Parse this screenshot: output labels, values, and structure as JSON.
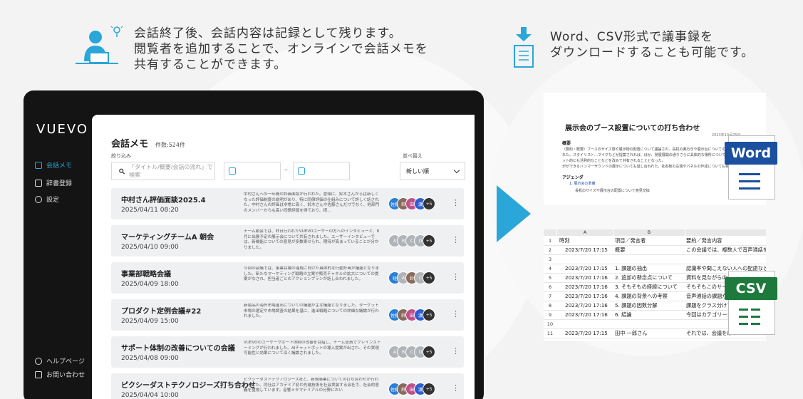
{
  "captions": {
    "left_lines": [
      "会話終了後、会話内容は記録として残ります。",
      "閲覧者を追加することで、オンラインで会話メモを",
      "共有することができます。"
    ],
    "right_lines": [
      "Word、CSV形式で議事録を",
      "ダウンロードすることも可能です。"
    ]
  },
  "app": {
    "logo": "VUEVO",
    "nav": [
      {
        "label": "会話メモ",
        "icon": "memo-icon",
        "active": true
      },
      {
        "label": "辞書登録",
        "icon": "dictionary-icon",
        "active": false
      },
      {
        "label": "設定",
        "icon": "gear-icon",
        "active": false
      }
    ],
    "nav_bottom": [
      {
        "label": "ヘルプページ",
        "icon": "help-icon"
      },
      {
        "label": "お問い合わせ",
        "icon": "mail-icon"
      }
    ],
    "page_title": "会話メモ",
    "count": "件数:524件",
    "filter_label": "絞り込み",
    "search_placeholder": "「タイトル/概要/会話の流れ」で検索",
    "date_separator": "–",
    "sort_label": "並べ替え",
    "sort_value": "新しい順",
    "rows": [
      {
        "title": "中村さん評価面談2025.4",
        "date": "2025/04/11 08:20",
        "summary": "中村さんへの一年間の評価面談が行われた。冒頭に、鈴木さんからは新しくなった評価制度の説明があり、特に同僚評価の仕組みについて詳しく話された。中村さんの評価は非常に高く、鈴木さんや佐藤さんだけでなく、他部門のメンバーからも高い同僚評価を得ており、様…",
        "avatars": [
          {
            "t": "佐藤",
            "c": "#2a7fd4"
          },
          {
            "t": "鈴",
            "c": "#8a6a5a"
          },
          {
            "t": "田",
            "c": "#c0508a"
          },
          {
            "t": "渡",
            "c": "#2f5fd0"
          },
          {
            "t": "+5",
            "c": "#333333"
          }
        ]
      },
      {
        "title": "マーケティングチームA 朝会",
        "date": "2025/04/10 09:00",
        "summary": "チーム朝会では、昨日行われたVUEVOユーザーの方へのインタビューと、8月に出展予定の展示会について共有されました。ユーザーインタビューでは、新機能についての意見が多数寄せられ、期待が高まっていることが分かりました。",
        "avatars": [
          {
            "t": "A",
            "c": "#b0b4b8"
          },
          {
            "t": "B",
            "c": "#b0b4b8"
          },
          {
            "t": "C",
            "c": "#b0b4b8"
          },
          {
            "t": "D",
            "c": "#b0b4b8"
          },
          {
            "t": "+5",
            "c": "#333333"
          }
        ]
      },
      {
        "title": "事業部戦略会議",
        "date": "2025/04/09 18:00",
        "summary": "今回の会議では、事業目標の達成に向けた具体的な行動計画が議題となりました。新たなマーケティング戦略の立案や販売チャネルの拡大についての提案がなされ、担当者ごとのアクションプランが話し合われました。",
        "avatars": [
          {
            "t": "短",
            "c": "#2a7fd4"
          },
          {
            "t": "A",
            "c": "#b0b4b8"
          },
          {
            "t": "鈴",
            "c": "#8a6a5a"
          },
          {
            "t": "C",
            "c": "#b0b4b8"
          },
          {
            "t": "+5",
            "c": "#333333"
          }
        ]
      },
      {
        "title": "プロダクト定例会議#22",
        "date": "2025/04/09 15:00",
        "summary": "新製品の海外市場進出についての議題が主な議題となりました。ターゲット市場の選定や市場調査の結果を基に、進出戦略についての詳細な議論が行われました。",
        "avatars": [
          {
            "t": "佐藤",
            "c": "#2a7fd4"
          },
          {
            "t": "鈴",
            "c": "#8a6a5a"
          },
          {
            "t": "田",
            "c": "#c0508a"
          },
          {
            "t": "渡",
            "c": "#2f5fd0"
          },
          {
            "t": "+5",
            "c": "#333333"
          }
        ]
      },
      {
        "title": "サポート体制の改善についての会議",
        "date": "2025/04/08 09:00",
        "summary": "VUEVOのユーザーサポート体制の改善を目指し、チーム全員でブレインストーミングが行われました。AIチャットボットの導入提案が出され、その実現可能性と効果について深く議論されました。",
        "avatars": [
          {
            "t": "A",
            "c": "#b0b4b8"
          },
          {
            "t": "B",
            "c": "#b0b4b8"
          },
          {
            "t": "C",
            "c": "#b0b4b8"
          },
          {
            "t": "D",
            "c": "#b0b4b8"
          },
          {
            "t": "+5",
            "c": "#333333"
          }
        ]
      },
      {
        "title": "ピクシーダストテクノロジーズ打ち合わせ",
        "date": "2025/04/04 10:00",
        "summary": "ピクシーダストテクノロジーズ社と、新規事業についての打ち合わせが行われました。同社はアカデミア初の先端技術を社会実装する会社で、社会的意義を重視しています。音響メタマテリアルの分野におい",
        "avatars": [
          {
            "t": "佐藤",
            "c": "#2a7fd4"
          },
          {
            "t": "鈴",
            "c": "#8a6a5a"
          },
          {
            "t": "田",
            "c": "#c0508a"
          },
          {
            "t": "渡",
            "c": "#2f5fd0"
          },
          {
            "t": "+5",
            "c": "#333333"
          }
        ]
      }
    ]
  },
  "word": {
    "badge": "Word",
    "title": "展示会のブース設置についての打ち合わせ",
    "date": "2023年10月25日",
    "h1": "概要",
    "p1": "（要約・概要）ブースのサイズ感や展示物の配置について議論され、長机の奥行きや展示台についての意見が交わされた。スタイリスト…マイクなどが提案されれば、ほか、発展展開の通りさらに具体的な場所については、パンフレット的にも活発的なことなどを改めて共有されることとなった。",
    "p2": "がができるバンマーサウンドの展示についても話し合われた。社名板の左端やパネルの作成についても検討された。",
    "h2": "アジェンダ",
    "item1": "1. 展示会の準備",
    "sub1": "長机のサイズや展示台の配置について意見交換"
  },
  "csv": {
    "badge": "CSV",
    "col_headers": [
      "A",
      "B"
    ],
    "headers": [
      "時刻",
      "項目／発言者",
      "要約／発言内容"
    ],
    "rows": [
      [
        "2023/7/20 17:15",
        "概要",
        "この会議では、複数人で音声通話をし"
      ],
      [
        "",
        "",
        ""
      ],
      [
        "2023/7/20 17:15",
        "1. 課題の抽出",
        "認識率や聞こえない人への配慮など、"
      ],
      [
        "2023/7/20 17:16",
        "2. 追加の懸念点について",
        "資料を見ながらの会話では、タイムラ"
      ],
      [
        "2023/7/20 17:16",
        "3. そもそもの経緯について",
        "そもそもこのサービス"
      ],
      [
        "2023/7/20 17:16",
        "4. 課題の背景への考察",
        "音声通話の課題が何か"
      ],
      [
        "2023/7/20 17:16",
        "5. 課題の因数分解",
        "課題をクラス分けする"
      ],
      [
        "2023/7/20 17:16",
        "6. 結論",
        "今回はカテゴリー1"
      ],
      [
        "",
        "",
        ""
      ],
      [
        "2023/7/20 17:15",
        "田中 一郎さん",
        "それでは、会議をは"
      ]
    ]
  },
  "colors": {
    "accent": "#2aa6d8",
    "word_blue": "#1b4fa0",
    "csv_green": "#1e7a3c"
  }
}
